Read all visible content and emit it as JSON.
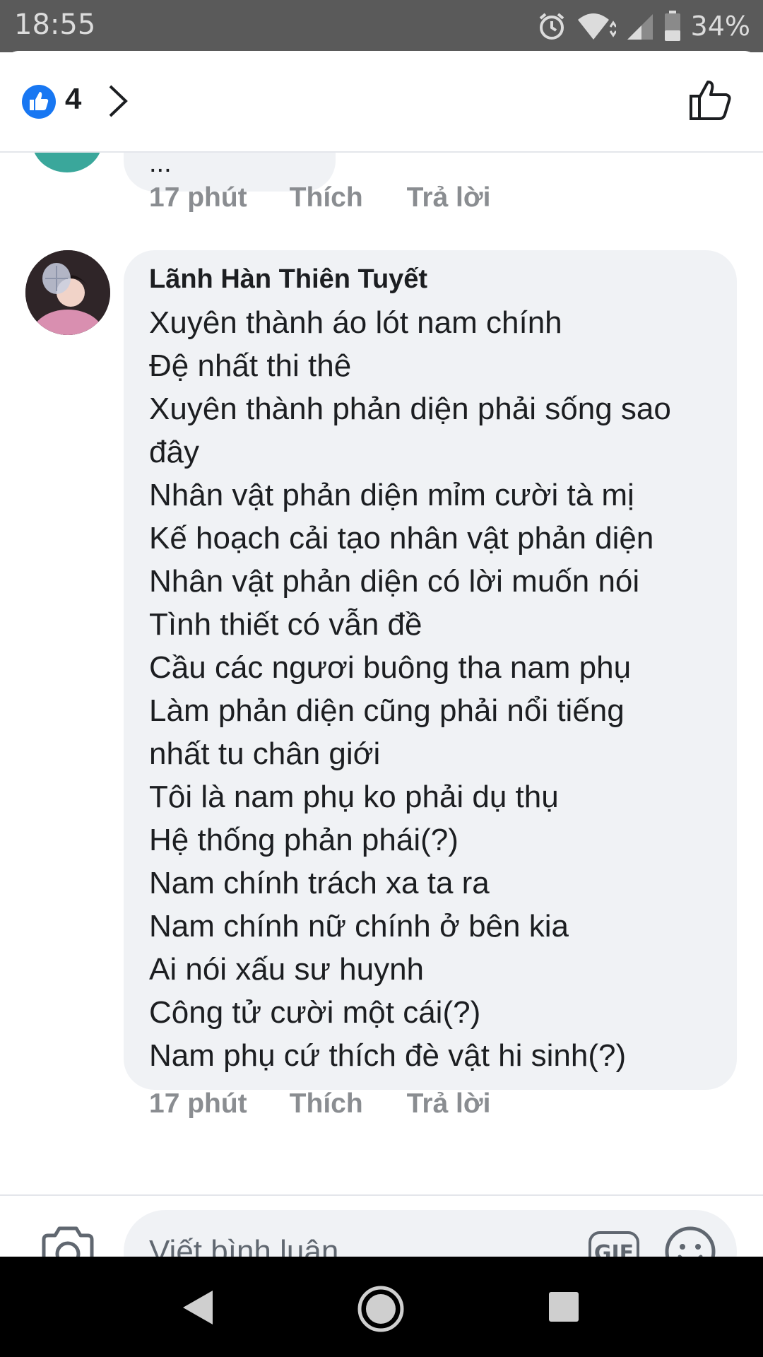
{
  "status_bar": {
    "time": "18:55",
    "battery": "34%",
    "icons": [
      "alarm-icon",
      "wifi-icon",
      "signal-icon",
      "battery-icon"
    ]
  },
  "header": {
    "reaction_icon": "like-reaction-icon",
    "reaction_count": "4",
    "chevron_icon": "chevron-right-icon",
    "like_button_icon": "thumbs-up-outline-icon"
  },
  "previous_comment": {
    "text": "...",
    "time": "17 phút",
    "like_label": "Thích",
    "reply_label": "Trả lời"
  },
  "comment": {
    "author": "Lãnh Hàn Thiên Tuyết",
    "lines": [
      "Xuyên thành áo lót nam chính",
      "Đệ nhất thi thê",
      "Xuyên thành phản diện phải sống sao",
      "đây",
      "Nhân vật phản diện mỉm cười tà mị",
      "Kế hoạch cải tạo nhân vật phản diện",
      "Nhân vật phản diện có lời muốn nói",
      "Tình thiết có vẫn đề",
      "Cầu các ngươi buông tha nam phụ",
      "Làm phản diện cũng phải nổi tiếng",
      "nhất tu chân giới",
      "Tôi là nam phụ ko phải dụ thụ",
      "Hệ thống phản phái(?)",
      "Nam chính trách xa ta ra",
      "Nam chính nữ chính ở bên kia",
      "Ai nói xấu sư huynh",
      "Công tử cười một cái(?)",
      "Nam phụ cứ thích đè vật hi sinh(?)"
    ],
    "time": "17 phút",
    "like_label": "Thích",
    "reply_label": "Trả lời"
  },
  "composer": {
    "placeholder": "Viết bình luận...",
    "gif_label": "GIF",
    "camera_icon": "camera-icon",
    "emoji_icon": "emoji-icon"
  },
  "nav_bar": {
    "icons": [
      "back-icon",
      "home-icon",
      "recents-icon"
    ]
  },
  "colors": {
    "facebook_blue": "#1877f2",
    "bubble_bg": "#f0f2f5",
    "meta_text": "#8a8d91",
    "status_bar_bg": "#5a5a5a"
  }
}
